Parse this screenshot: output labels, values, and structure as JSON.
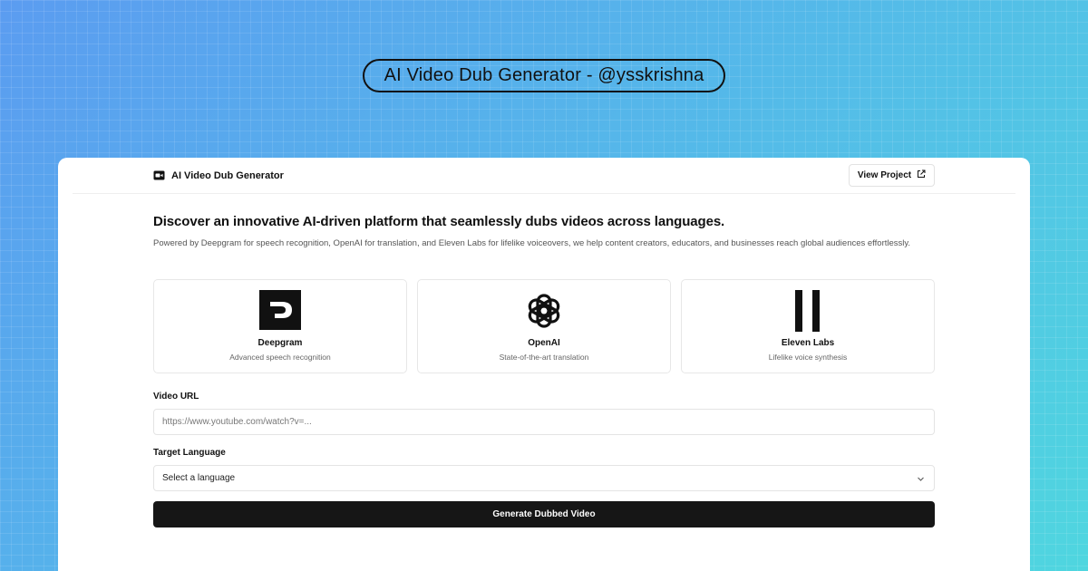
{
  "hero": {
    "title": "AI Video Dub Generator - @ysskrishna"
  },
  "header": {
    "app_name": "AI Video Dub Generator",
    "app_icon": "video-camera-icon",
    "view_project_label": "View Project",
    "view_project_icon": "external-link-icon"
  },
  "intro": {
    "headline": "Discover an innovative AI-driven platform that seamlessly dubs videos across languages.",
    "description": "Powered by Deepgram for speech recognition, OpenAI for translation, and Eleven Labs for lifelike voiceovers, we help content creators, educators, and businesses reach global audiences effortlessly."
  },
  "providers": [
    {
      "name": "Deepgram",
      "description": "Advanced speech recognition",
      "icon": "deepgram-logo-icon"
    },
    {
      "name": "OpenAI",
      "description": "State-of-the-art translation",
      "icon": "openai-logo-icon"
    },
    {
      "name": "Eleven Labs",
      "description": "Lifelike voice synthesis",
      "icon": "elevenlabs-logo-icon"
    }
  ],
  "form": {
    "video_url_label": "Video URL",
    "video_url_placeholder": "https://www.youtube.com/watch?v=...",
    "video_url_value": "",
    "language_label": "Target Language",
    "language_selected": "Select a language",
    "submit_label": "Generate Dubbed Video"
  },
  "colors": {
    "background_start": "#5b9cf0",
    "background_end": "#4fd6df",
    "button": "#161616",
    "card": "#ffffff"
  }
}
